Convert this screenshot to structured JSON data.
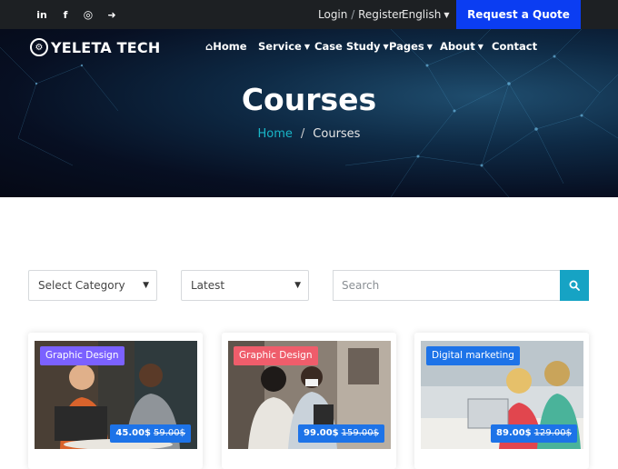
{
  "topbar": {
    "social": [
      {
        "name": "linkedin-icon",
        "glyph": "in"
      },
      {
        "name": "facebook-icon",
        "glyph": "f"
      },
      {
        "name": "instagram-icon",
        "glyph": "◎"
      },
      {
        "name": "sign-in-icon",
        "glyph": "➜"
      }
    ],
    "login": "Login",
    "separator": "/",
    "register": "Register",
    "language": "English",
    "quote_button": "Request a Quote"
  },
  "header": {
    "logo_text": "YELETA TECH",
    "nav": [
      {
        "label": "Home",
        "icon": "home-icon"
      },
      {
        "label": "Service",
        "dropdown": true
      },
      {
        "label": "Case Study",
        "dropdown": true
      },
      {
        "label": "Pages",
        "dropdown": true
      },
      {
        "label": "About",
        "dropdown": true
      },
      {
        "label": "Contact"
      }
    ]
  },
  "hero": {
    "title": "Courses",
    "breadcrumb": {
      "home": "Home",
      "separator": "/",
      "current": "Courses"
    }
  },
  "filters": {
    "category": "Select Category",
    "sort": "Latest",
    "search_placeholder": "Search"
  },
  "courses": [
    {
      "category": "Graphic Design",
      "category_color": "#7b61ff",
      "price": "45.00$",
      "old_price": "59.00$"
    },
    {
      "category": "Graphic Design",
      "category_color": "#ef5d6b",
      "price": "99.00$",
      "old_price": "159.00$"
    },
    {
      "category": "Digital marketing",
      "category_color": "#1d73e8",
      "price": "89.00$",
      "old_price": "129.00$"
    }
  ],
  "colors": {
    "accent_blue": "#0b3df2",
    "teal": "#16a3c4",
    "price_blue": "#1d73e8"
  }
}
